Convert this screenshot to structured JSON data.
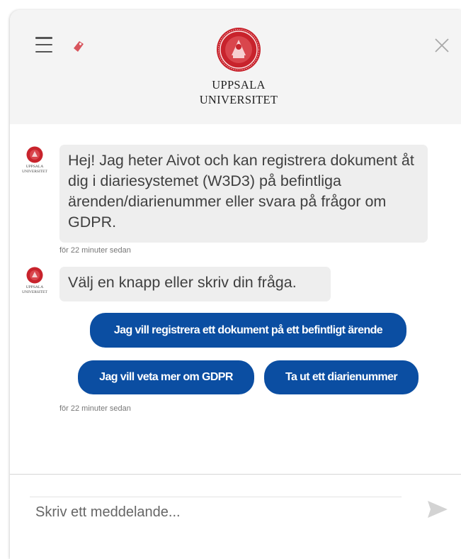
{
  "header": {
    "logo_line1": "UPPSALA",
    "logo_line2": "UNIVERSITET",
    "menu_icon": "hamburger-icon",
    "tag_icon": "tag-icon",
    "close_icon": "close-icon"
  },
  "avatar": {
    "caption_line1": "UPPSALA",
    "caption_line2": "UNIVERSITET"
  },
  "messages": [
    {
      "text": "Hej! Jag heter Aivot och kan registrera dokument åt dig i diariesystemet (W3D3) på befintliga ärenden/diarienummer eller svara på frågor om GDPR.",
      "timestamp": "för 22 minuter sedan"
    },
    {
      "text": "Välj en knapp eller skriv din fråga.",
      "timestamp": "för 22 minuter sedan"
    }
  ],
  "quick_replies": [
    "Jag vill registrera ett dokument på ett befintligt ärende",
    "Jag vill veta mer om GDPR",
    "Ta ut ett diarienummer"
  ],
  "composer": {
    "placeholder": "Skriv ett meddelande...",
    "send_icon": "send-icon"
  },
  "colors": {
    "brand_red": "#c8232c",
    "button_blue": "#0b4ea2",
    "bubble_gray": "#eeeeee",
    "header_gray": "#f4f4f4"
  }
}
